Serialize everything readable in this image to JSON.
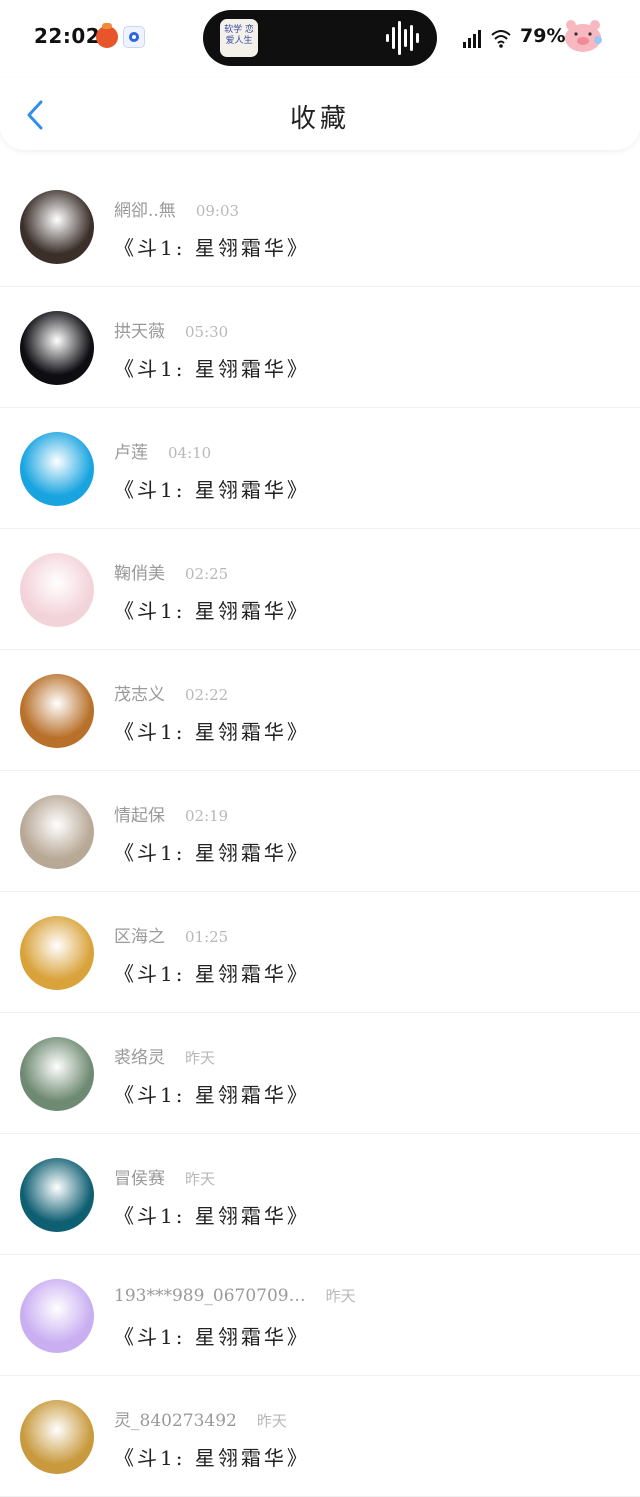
{
  "status_bar": {
    "time": "22:02",
    "island_cover_text": "软学 恋爱人生",
    "battery": "79%"
  },
  "nav": {
    "title": "收藏"
  },
  "items": [
    {
      "name": "網卻..無",
      "time": "09:03",
      "message": "《斗1: 星翎霜华》",
      "avatar_color": "#3b2f2a"
    },
    {
      "name": "拱天薇",
      "time": "05:30",
      "message": "《斗1: 星翎霜华》",
      "avatar_color": "#0d0d12"
    },
    {
      "name": "卢莲",
      "time": "04:10",
      "message": "《斗1: 星翎霜华》",
      "avatar_color": "#19a4e0"
    },
    {
      "name": "鞠俏美",
      "time": "02:25",
      "message": "《斗1: 星翎霜华》",
      "avatar_color": "#f3d3da"
    },
    {
      "name": "茂志义",
      "time": "02:22",
      "message": "《斗1: 星翎霜华》",
      "avatar_color": "#b8702a"
    },
    {
      "name": "情起保",
      "time": "02:19",
      "message": "《斗1: 星翎霜华》",
      "avatar_color": "#b8a896"
    },
    {
      "name": "区海之",
      "time": "01:25",
      "message": "《斗1: 星翎霜华》",
      "avatar_color": "#d9a23a"
    },
    {
      "name": "裘络灵",
      "time": "昨天",
      "message": "《斗1: 星翎霜华》",
      "avatar_color": "#6f8a72"
    },
    {
      "name": "冒侯赛",
      "time": "昨天",
      "message": "《斗1: 星翎霜华》",
      "avatar_color": "#0f5f73"
    },
    {
      "name": "193***989_0670709…",
      "time": "昨天",
      "message": "《斗1: 星翎霜华》",
      "avatar_color": "#c9aef2"
    },
    {
      "name": "灵_840273492",
      "time": "昨天",
      "message": "《斗1: 星翎霜华》",
      "avatar_color": "#c89a3d"
    }
  ]
}
